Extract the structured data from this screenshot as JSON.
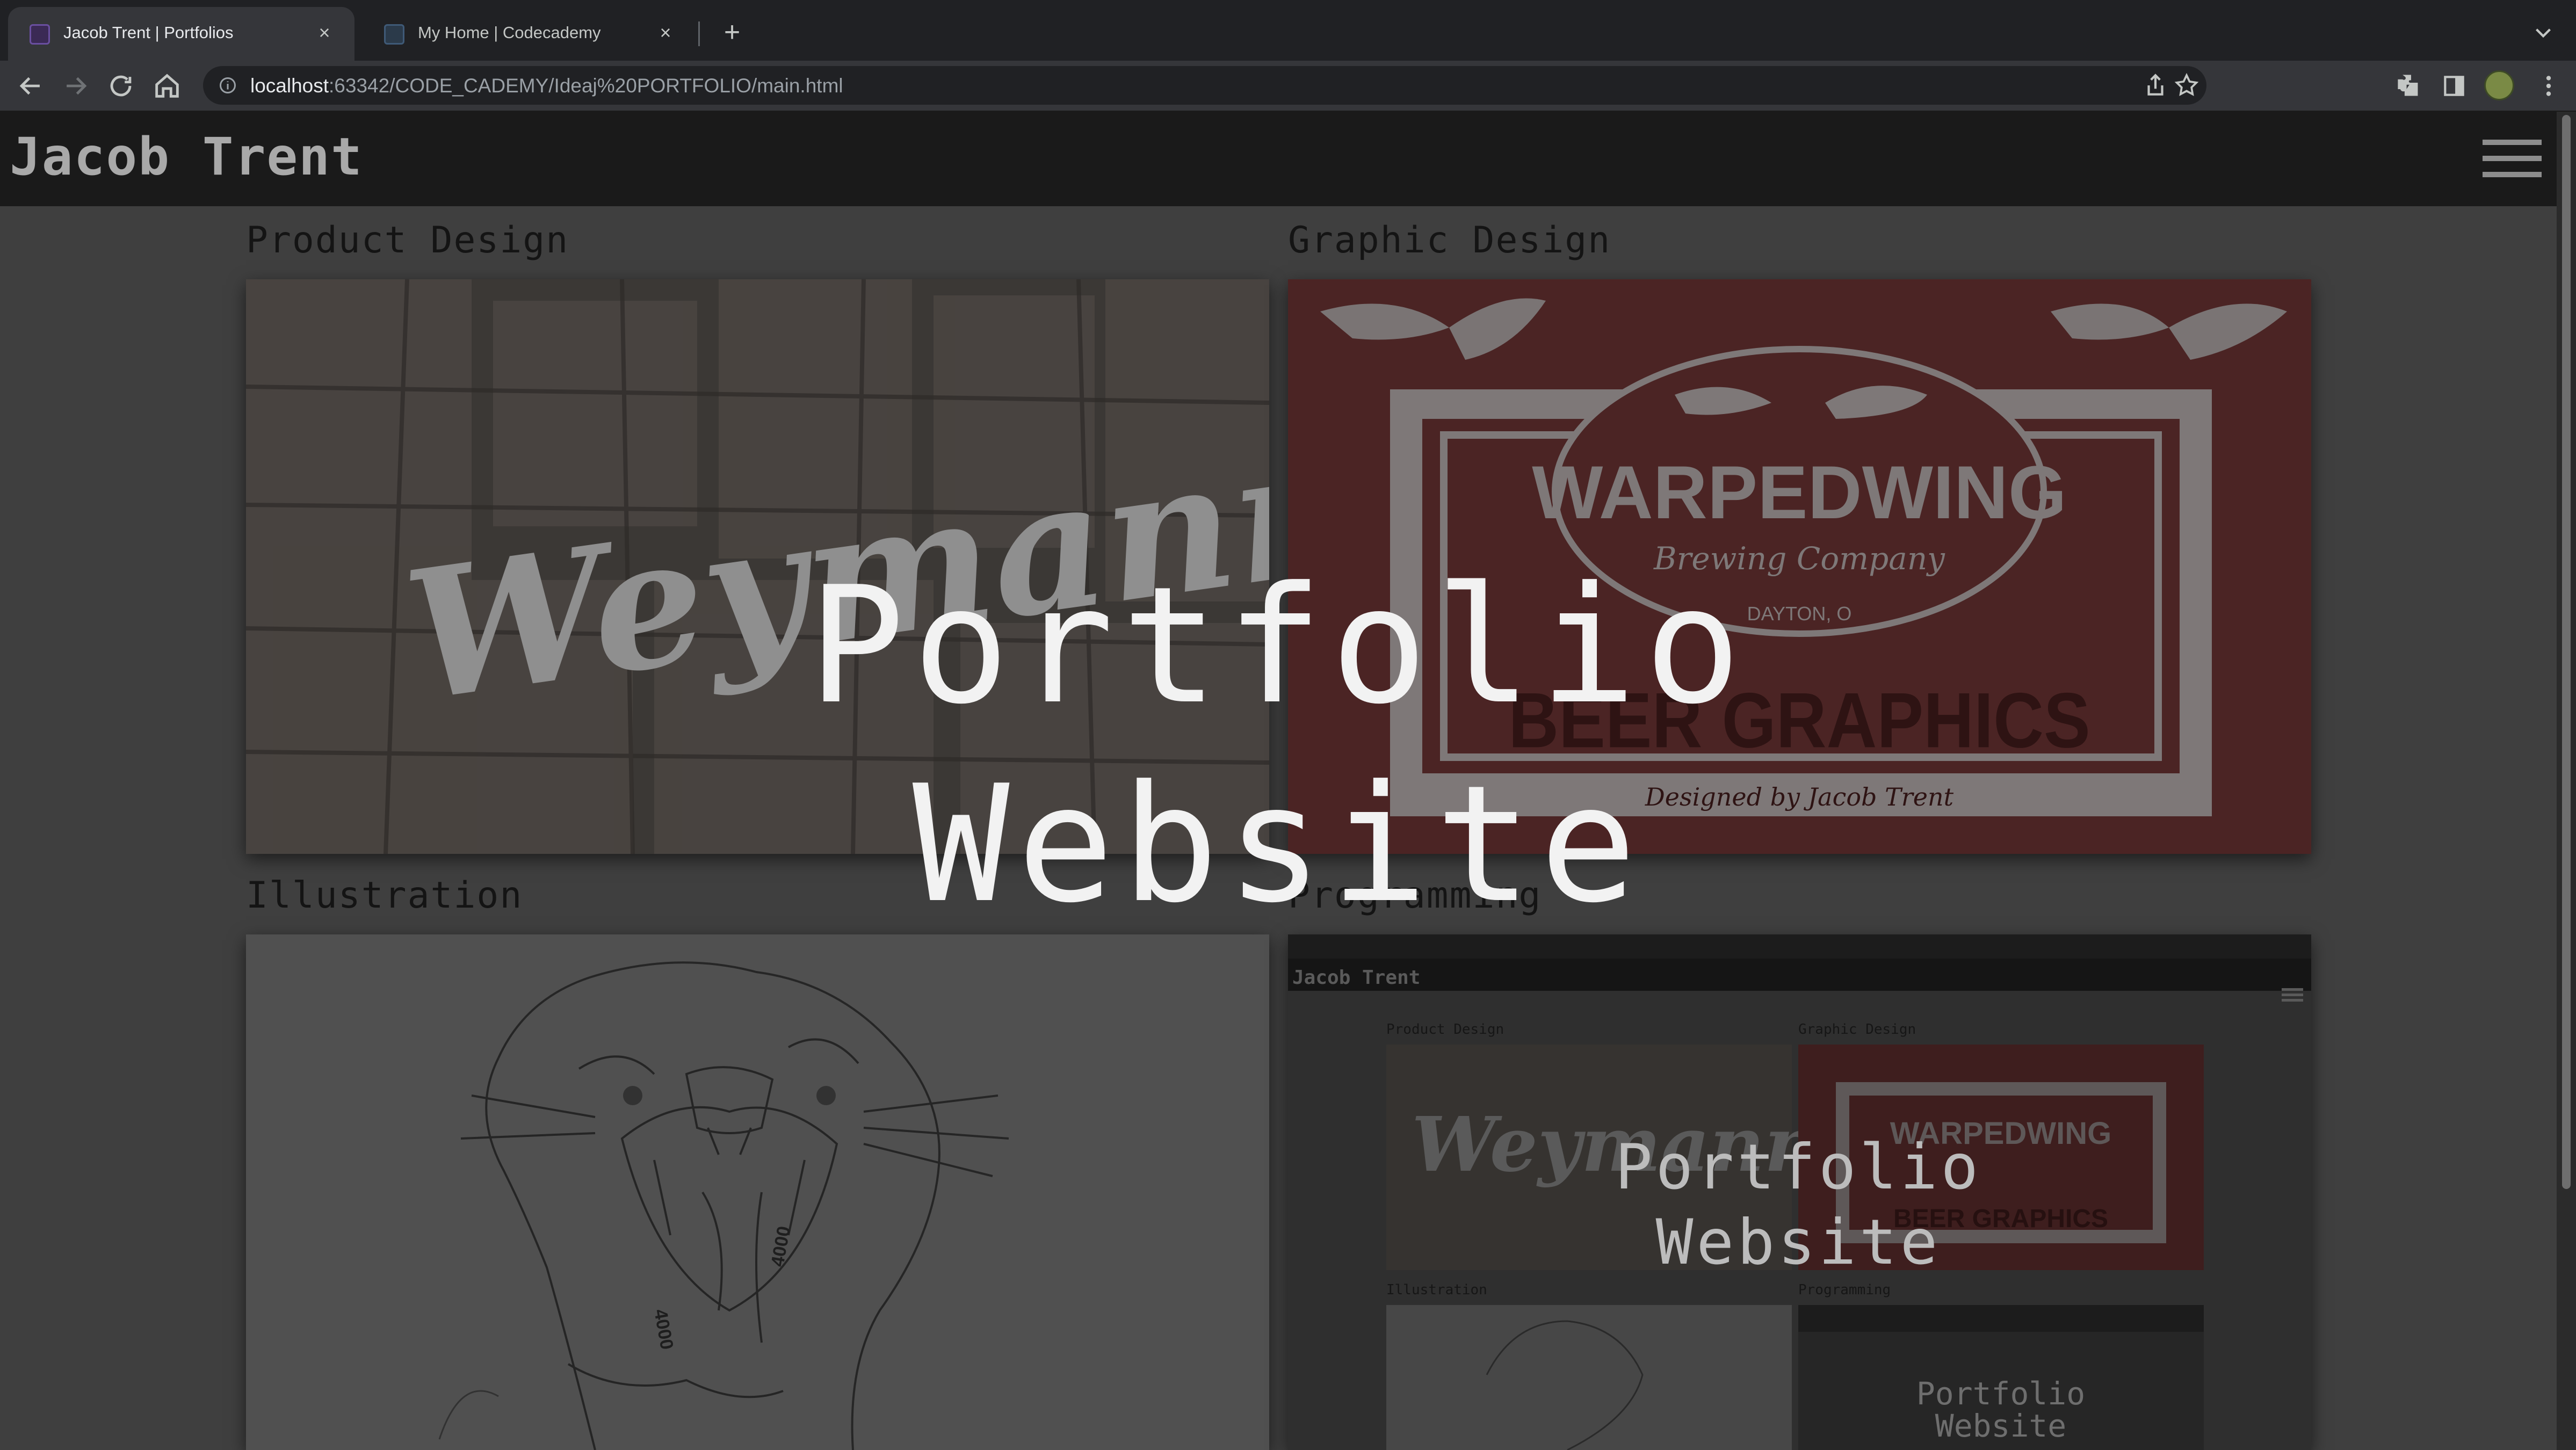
{
  "browser": {
    "tabs": [
      {
        "label": "Jacob Trent | Portfolios",
        "active": true,
        "favicon": "webstorm-icon"
      },
      {
        "label": "My Home | Codecademy",
        "active": false,
        "favicon": "codecademy-icon"
      }
    ],
    "close_glyph": "×",
    "new_tab_glyph": "+",
    "url_host": "localhost",
    "url_rest": ":63342/CODE_CADEMY/Ideaj%20PORTFOLIO/main.html"
  },
  "site": {
    "title": "Jacob Trent",
    "hero_line1": "Portfolio",
    "hero_line2": "Website",
    "sections": [
      {
        "title": "Product Design",
        "image_text": "Weymann"
      },
      {
        "title": "Graphic Design",
        "image_text": "WARPEDWING",
        "image_subtext": "Brewing Company",
        "image_location": "DAYTON, O",
        "image_banner": "BEER GRAPHICS",
        "image_credit": "Designed by Jacob Trent"
      },
      {
        "title": "Illustration"
      },
      {
        "title": "Programming",
        "preview_title": "Jacob Trent",
        "preview_sections": [
          "Product Design",
          "Graphic Design",
          "Illustration",
          "Programming"
        ],
        "preview_hero_line1": "Portfolio",
        "preview_hero_line2": "Website"
      }
    ]
  },
  "colors": {
    "chrome_bg": "#202124",
    "header_bg": "#1a1a1a",
    "page_bg": "#3f3f3f",
    "graphic_red": "#4b2424",
    "hero_text": "#f2f2f2"
  }
}
